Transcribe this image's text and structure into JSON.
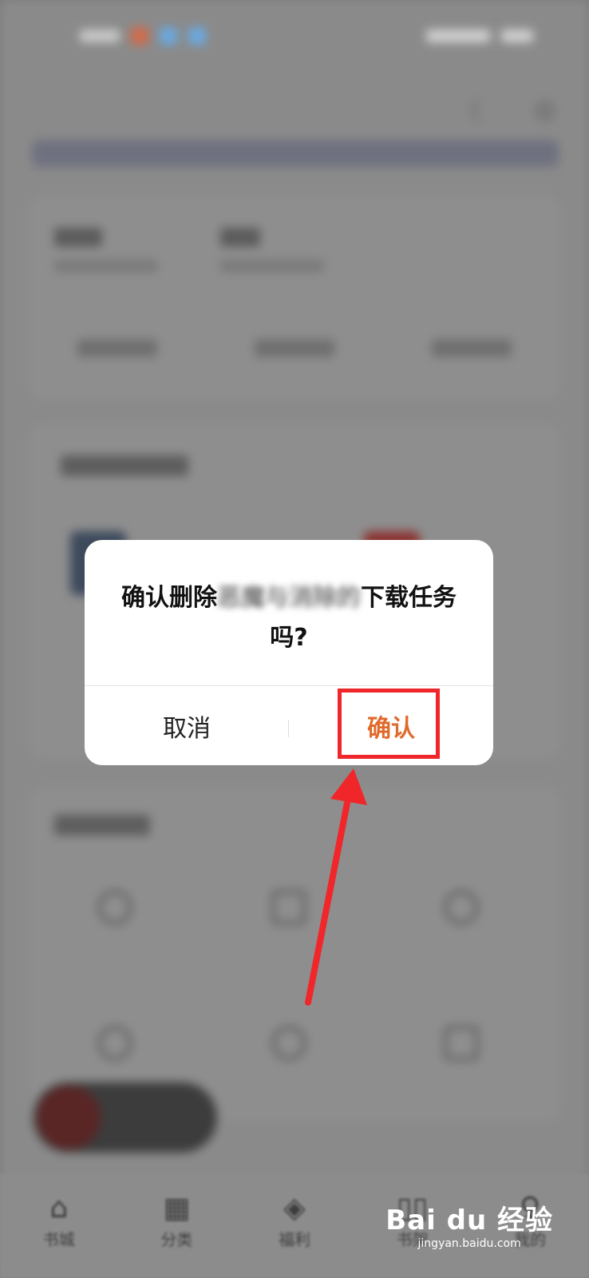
{
  "dialog": {
    "message_prefix": "确认删除",
    "message_blurred": "恶魔与消除的",
    "message_suffix": "下载任务吗?",
    "cancel_label": "取消",
    "confirm_label": "确认",
    "confirm_color": "#e06a2c"
  },
  "tab_bar": {
    "items": [
      {
        "label": "书城",
        "icon": "home-icon"
      },
      {
        "label": "分类",
        "icon": "grid-icon"
      },
      {
        "label": "福利",
        "icon": "coin-icon"
      },
      {
        "label": "书架",
        "icon": "book-icon"
      },
      {
        "label": "我的",
        "icon": "user-icon"
      }
    ]
  },
  "annotation": {
    "highlight_color": "#f0262a",
    "target": "confirm-button"
  },
  "watermark": {
    "main": "Bai du 经验",
    "sub": "jingyan.baidu.com"
  }
}
